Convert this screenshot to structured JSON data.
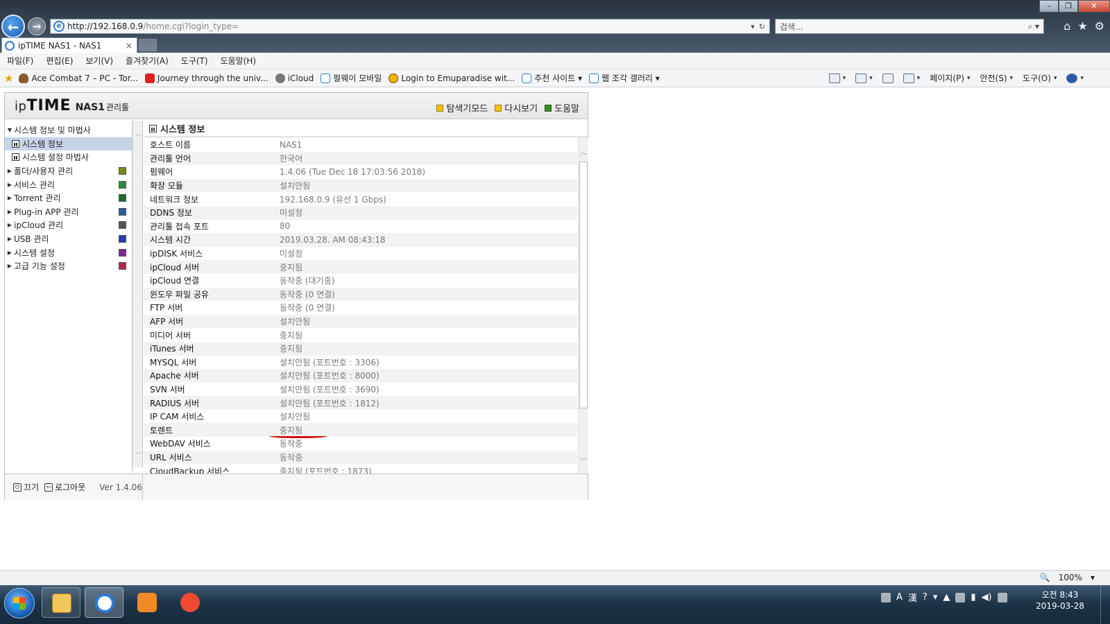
{
  "browser": {
    "url_host": "http://192.168.0.9",
    "url_path": "/home.cgi?login_type=",
    "search_placeholder": "검색...",
    "tab_title": "ipTIME NAS1 - NAS1",
    "tab_close": "×"
  },
  "menu": [
    "파일(F)",
    "편집(E)",
    "보기(V)",
    "즐겨찾기(A)",
    "도구(T)",
    "도움말(H)"
  ],
  "favorites": [
    {
      "icon": "bird",
      "label": "Ace Combat 7 – PC - Tor..."
    },
    {
      "icon": "yt",
      "label": "Journey through the univ..."
    },
    {
      "icon": "apple",
      "label": "iCloud"
    },
    {
      "icon": "page",
      "label": "펄웨이 모바일"
    },
    {
      "icon": "emu",
      "label": "Login to Emuparadise wit..."
    },
    {
      "icon": "page",
      "label": "추천 사이트 ▾"
    },
    {
      "icon": "page",
      "label": "웹 조각 갤러리 ▾"
    }
  ],
  "cmdbar": {
    "page": "페이지(P)",
    "safety": "안전(S)",
    "tools": "도구(O)"
  },
  "app": {
    "logo_ip": "ip",
    "logo_time": "TIME",
    "logo_nas": "NAS1",
    "logo_kr": "관리툴",
    "header_links": [
      "탐색기모드",
      "다시보기",
      "도움말"
    ],
    "tree": [
      {
        "label": "시스템 정보 및 마법사",
        "level": 0,
        "open": true
      },
      {
        "label": "시스템 정보",
        "level": 1,
        "active": true
      },
      {
        "label": "시스템 설정 마법사",
        "level": 1
      },
      {
        "label": "폴더/사용자 관리",
        "level": 0,
        "color": "#7a8a1a"
      },
      {
        "label": "서비스 관리",
        "level": 0,
        "color": "#2a8a3a"
      },
      {
        "label": "Torrent 관리",
        "level": 0,
        "color": "#1a6a2a"
      },
      {
        "label": "Plug-in APP 관리",
        "level": 0,
        "color": "#2a5aa0"
      },
      {
        "label": "ipCloud 관리",
        "level": 0,
        "color": "#555555"
      },
      {
        "label": "USB 관리",
        "level": 0,
        "color": "#2a3ab0"
      },
      {
        "label": "시스템 설정",
        "level": 0,
        "color": "#7a2a9a"
      },
      {
        "label": "고급 기능 설정",
        "level": 0,
        "color": "#b02a4a"
      }
    ],
    "footer": {
      "power": "끄기",
      "logout": "로그아웃",
      "version": "Ver 1.4.06"
    },
    "main_title": "시스템 정보",
    "rows": [
      {
        "key": "호스트 이름",
        "value": "NAS1"
      },
      {
        "key": "관리툴 언어",
        "value": "한국어"
      },
      {
        "key": "펌웨어",
        "value": "1.4.06 (Tue Dec 18 17:03:56 2018)"
      },
      {
        "key": "확장 모듈",
        "value": "설치안됨"
      },
      {
        "key": "네트워크 정보",
        "value": "192.168.0.9 (유선 1 Gbps)"
      },
      {
        "key": "DDNS 정보",
        "value": "미설정"
      },
      {
        "key": "관리툴 접속 포트",
        "value": "80"
      },
      {
        "key": "시스템 시간",
        "value": "2019.03.28. AM 08:43:18"
      },
      {
        "key": "ipDISK 서비스",
        "value": "미설정"
      },
      {
        "key": "ipCloud 서버",
        "value": "중지됨"
      },
      {
        "key": "ipCloud 연결",
        "value": "동작중 (대기중)"
      },
      {
        "key": "윈도우 파일 공유",
        "value": "동작중 (0 연결)"
      },
      {
        "key": "FTP 서버",
        "value": "동작중 (0 연결)"
      },
      {
        "key": "AFP 서버",
        "value": "설치안됨"
      },
      {
        "key": "미디어 서버",
        "value": "중지됨"
      },
      {
        "key": "iTunes 서버",
        "value": "중지됨"
      },
      {
        "key": "MYSQL 서버",
        "value": "설치안됨 (포트번호 : 3306)"
      },
      {
        "key": "Apache 서버",
        "value": "설치안됨 (포트번호 : 8000)"
      },
      {
        "key": "SVN 서버",
        "value": "설치안됨 (포트번호 : 3690)"
      },
      {
        "key": "RADIUS 서버",
        "value": "설치안됨 (포트번호 : 1812)"
      },
      {
        "key": "IP CAM 서비스",
        "value": "설치안됨"
      },
      {
        "key": "토렌트",
        "value": "중지됨"
      },
      {
        "key": "WebDAV 서비스",
        "value": "동작중"
      },
      {
        "key": "URL 서비스",
        "value": "동작중"
      },
      {
        "key": "CloudBackup 서비스",
        "value": "중지됨 (포트번호 : 1873)"
      }
    ]
  },
  "status": {
    "zoom": "100%"
  },
  "taskbar": {
    "clock_time": "오전 8:43",
    "clock_date": "2019-03-28"
  },
  "colors": {
    "accent_red": "#d01010",
    "selected_row": "#c6d4e8"
  }
}
